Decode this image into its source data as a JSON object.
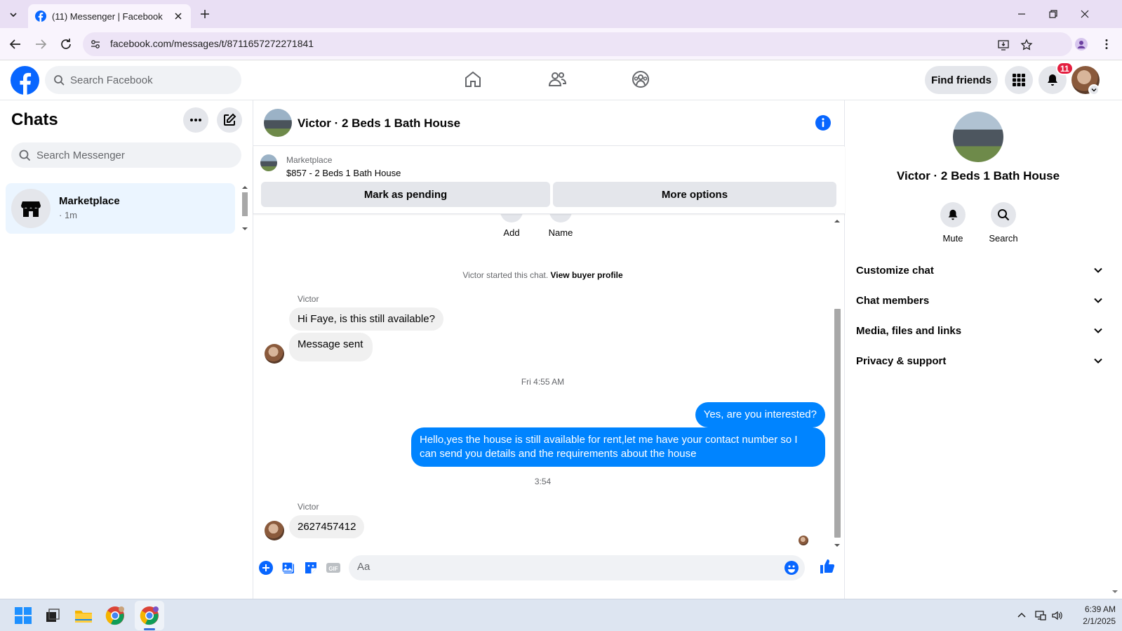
{
  "browser": {
    "tab_title": "(11) Messenger | Facebook",
    "url": "facebook.com/messages/t/8711657272271841"
  },
  "header": {
    "search_placeholder": "Search Facebook",
    "find_friends": "Find friends",
    "notification_count": "11",
    "brand_color": "#0866ff"
  },
  "chats": {
    "title": "Chats",
    "search_placeholder": "Search Messenger",
    "items": [
      {
        "name": "Marketplace",
        "time": "· 1m"
      }
    ]
  },
  "conversation": {
    "title": "Victor · 2 Beds 1 Bath House",
    "marketplace": {
      "label": "Marketplace",
      "listing": "$857 - 2 Beds 1 Bath House",
      "mark_pending": "Mark as pending",
      "more_options": "More options"
    },
    "partial_actions": [
      "Add",
      "Name"
    ],
    "started_text": "Victor started this chat.",
    "view_profile": "View buyer profile",
    "messages": [
      {
        "sender": "Victor",
        "text": "Hi Faye, is this still available?"
      },
      {
        "text": "Message sent"
      },
      {
        "timestamp": "Fri 4:55 AM"
      },
      {
        "text": "Yes, are you interested?"
      },
      {
        "text": "Hello,yes the house is still available for rent,let me have your contact number   so I can send you details and the requirements about the house"
      },
      {
        "timestamp": "3:54"
      },
      {
        "sender": "Victor",
        "text": "2627457412"
      }
    ],
    "composer_placeholder": "Aa",
    "outgoing_color": "#0084ff"
  },
  "info_panel": {
    "name": "Victor · 2 Beds 1 Bath House",
    "actions": [
      "Mute",
      "Search"
    ],
    "sections": [
      "Customize chat",
      "Chat members",
      "Media, files and links",
      "Privacy & support"
    ]
  },
  "taskbar": {
    "time": "6:39 AM",
    "date": "2/1/2025"
  }
}
